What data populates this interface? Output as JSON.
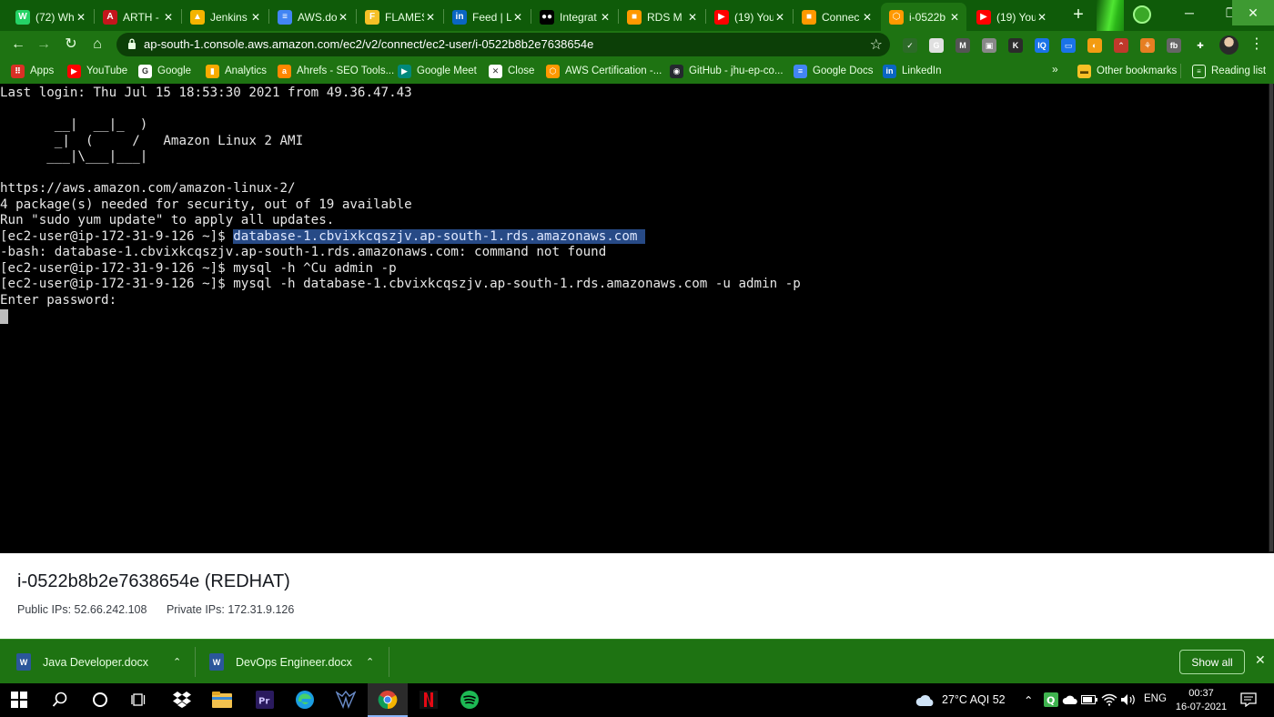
{
  "browser": {
    "tabs": [
      {
        "title": "(72) Wh",
        "icon": "whatsapp-icon",
        "color": "#25d366",
        "glyph": "W"
      },
      {
        "title": "ARTH -",
        "icon": "arth-icon",
        "color": "#c4161c",
        "glyph": "A"
      },
      {
        "title": "Jenkins",
        "icon": "google-drive-icon",
        "color": "#f4b400",
        "glyph": "▲"
      },
      {
        "title": "AWS.do",
        "icon": "google-docs-icon",
        "color": "#4285f4",
        "glyph": "≡"
      },
      {
        "title": "FLAMES",
        "icon": "flames-icon",
        "color": "#f6c026",
        "glyph": "F"
      },
      {
        "title": "Feed | L",
        "icon": "linkedin-icon",
        "color": "#0a66c2",
        "glyph": "in"
      },
      {
        "title": "Integrat",
        "icon": "medium-icon",
        "color": "#000000",
        "glyph": "●●"
      },
      {
        "title": "RDS M",
        "icon": "aws-icon",
        "color": "#ff9900",
        "glyph": "■"
      },
      {
        "title": "(19) You",
        "icon": "youtube-icon",
        "color": "#ff0000",
        "glyph": "▶"
      },
      {
        "title": "Connec",
        "icon": "aws-icon",
        "color": "#ff9900",
        "glyph": "■"
      },
      {
        "title": "i-0522b",
        "icon": "aws-ec2-icon",
        "color": "#ff9900",
        "glyph": "⬡"
      },
      {
        "title": "(19) You",
        "icon": "youtube-icon",
        "color": "#ff0000",
        "glyph": "▶"
      }
    ],
    "active_tab": 10,
    "url": "ap-south-1.console.aws.amazon.com/ec2/v2/connect/ec2-user/i-0522b8b2e7638654e",
    "extensions": [
      {
        "icon": "shield-extension-icon",
        "color": "#2d6b28",
        "glyph": "✓"
      },
      {
        "icon": "grammarly-extension-icon",
        "color": "#e0e0e0",
        "glyph": "G"
      },
      {
        "icon": "m-extension-icon",
        "color": "#555555",
        "glyph": "M"
      },
      {
        "icon": "photo-extension-icon",
        "color": "#888888",
        "glyph": "▣"
      },
      {
        "icon": "k-extension-icon",
        "color": "#2b2b2b",
        "glyph": "K"
      },
      {
        "icon": "iq-extension-icon",
        "color": "#1a73e8",
        "glyph": "IQ"
      },
      {
        "icon": "screen-extension-icon",
        "color": "#1a73e8",
        "glyph": "▭"
      },
      {
        "icon": "react-extension-icon",
        "color": "#f39c12",
        "glyph": "◐"
      },
      {
        "icon": "graph-extension-icon",
        "color": "#c0392b",
        "glyph": "⌃"
      },
      {
        "icon": "plant-extension-icon",
        "color": "#e67e22",
        "glyph": "⚘"
      },
      {
        "icon": "fb-extension-icon",
        "color": "#666666",
        "glyph": "fb"
      },
      {
        "icon": "puzzle-extension-icon",
        "color": "#1e7312",
        "glyph": "✚"
      }
    ],
    "bookmarks": [
      {
        "label": "Apps",
        "icon": "apps-grid-icon",
        "color": "#d93025",
        "glyph": "⠿"
      },
      {
        "label": "YouTube",
        "icon": "youtube-icon",
        "color": "#ff0000",
        "glyph": "▶"
      },
      {
        "label": "Google",
        "icon": "google-icon",
        "color": "#ffffff",
        "glyph": "G"
      },
      {
        "label": "Analytics",
        "icon": "analytics-icon",
        "color": "#f9ab00",
        "glyph": "▮"
      },
      {
        "label": "Ahrefs - SEO Tools...",
        "icon": "ahrefs-icon",
        "color": "#ff8800",
        "glyph": "a"
      },
      {
        "label": "Google Meet",
        "icon": "google-meet-icon",
        "color": "#00897b",
        "glyph": "▶"
      },
      {
        "label": "Close",
        "icon": "close-bookmark-icon",
        "color": "#ffffff",
        "glyph": "✕"
      },
      {
        "label": "AWS Certification -...",
        "icon": "aws-icon",
        "color": "#ff9900",
        "glyph": "⬡"
      },
      {
        "label": "GitHub - jhu-ep-co...",
        "icon": "github-icon",
        "color": "#24292e",
        "glyph": "◉"
      },
      {
        "label": "Google Docs",
        "icon": "google-docs-icon",
        "color": "#4285f4",
        "glyph": "≡"
      },
      {
        "label": "LinkedIn",
        "icon": "linkedin-icon",
        "color": "#0a66c2",
        "glyph": "in"
      }
    ],
    "more_bookmarks": "»",
    "other_bookmarks": "Other bookmarks",
    "reading_list": "Reading list"
  },
  "terminal": {
    "lines": [
      {
        "text": "Last login: Thu Jul 15 18:53:30 2021 from 49.36.47.43"
      },
      {
        "text": ""
      },
      {
        "text": "       __|  __|_  )"
      },
      {
        "text": "       _|  (     /   Amazon Linux 2 AMI"
      },
      {
        "text": "      ___|\\___|___|"
      },
      {
        "text": ""
      },
      {
        "text": "https://aws.amazon.com/amazon-linux-2/"
      },
      {
        "text": "4 package(s) needed for security, out of 19 available"
      },
      {
        "text": "Run \"sudo yum update\" to apply all updates."
      },
      {
        "text": "[ec2-user@ip-172-31-9-126 ~]$ ",
        "highlight": "database-1.cbvixkcqszjv.ap-south-1.rds.amazonaws.com "
      },
      {
        "text": "-bash: database-1.cbvixkcqszjv.ap-south-1.rds.amazonaws.com: command not found"
      },
      {
        "text": "[ec2-user@ip-172-31-9-126 ~]$ mysql -h ^Cu admin -p"
      },
      {
        "text": "[ec2-user@ip-172-31-9-126 ~]$ mysql -h database-1.cbvixkcqszjv.ap-south-1.rds.amazonaws.com -u admin -p"
      },
      {
        "text": "Enter password:"
      }
    ]
  },
  "instance": {
    "title": "i-0522b8b2e7638654e (REDHAT)",
    "public_ips": "Public IPs: 52.66.242.108",
    "private_ips": "Private IPs: 172.31.9.126"
  },
  "downloads": {
    "items": [
      {
        "name": "Java Developer.docx"
      },
      {
        "name": "DevOps Engineer.docx"
      }
    ],
    "show_all": "Show all"
  },
  "taskbar": {
    "weather": "27°C  AQI 52",
    "language": "ENG",
    "time": "00:37",
    "date": "16-07-2021"
  }
}
